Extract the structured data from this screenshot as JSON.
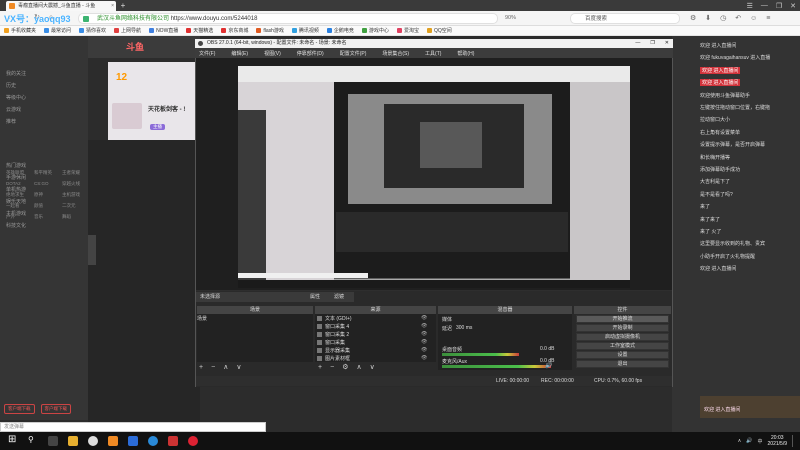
{
  "browser": {
    "tab_title": "毒瘤直播间大震撼_斗鱼直播 - 斗鱼",
    "tab_close": "×",
    "new_tab": "+",
    "window_controls": [
      "☰",
      "—",
      "❐",
      "✕"
    ],
    "nav": {
      "back": "‹",
      "forward": "›",
      "refresh": "↻",
      "home": "⌂"
    },
    "url_site": "武汉斗鱼网络科技有限公司",
    "url": "https://www.douyu.com/5244018",
    "zoom": "90%",
    "search_placeholder": "百度搜索",
    "bookmarks": [
      {
        "label": "手机收藏夹",
        "color": "#f0a020"
      },
      {
        "label": "最常访问",
        "color": "#3a8ee6"
      },
      {
        "label": "猜你喜欢",
        "color": "#3a8ee6"
      },
      {
        "label": "上网导航",
        "color": "#e04040"
      },
      {
        "label": "NOW直播",
        "color": "#4080e0"
      },
      {
        "label": "天猫精选",
        "color": "#e03030"
      },
      {
        "label": "京东商城",
        "color": "#e03030"
      },
      {
        "label": "flash游戏",
        "color": "#e05a20"
      },
      {
        "label": "腾讯视频",
        "color": "#30a0e0"
      },
      {
        "label": "企鹅电竞",
        "color": "#2a80e0"
      },
      {
        "label": "游戏中心",
        "color": "#40a040"
      },
      {
        "label": "爱淘宝",
        "color": "#e04060"
      },
      {
        "label": "QQ空间",
        "color": "#e0a020"
      }
    ]
  },
  "watermark": "VX号：yaoqq93",
  "douyu": {
    "logo": "斗鱼",
    "room_level": "12",
    "room_title": "天花板剑客 - !",
    "room_tag": "主播",
    "left_nav": {
      "items": [
        "我的关注",
        "历史",
        "等级中心",
        "云游戏",
        "推荐",
        "热门游戏",
        "手游休闲",
        "单机热游",
        "娱乐天地",
        "主机游戏",
        "科技文化"
      ],
      "grid": [
        "英雄联盟",
        "和平精英",
        "王者荣耀",
        "DOTA2",
        "CS:GO",
        "穿越火线",
        "绝地求生",
        "原神",
        "主机游戏",
        "一起看",
        "颜值",
        "二次元",
        "户外",
        "音乐",
        "舞蹈"
      ]
    },
    "nav_buttons": [
      "客户端下载",
      "客户端下载"
    ]
  },
  "obs": {
    "title": "OBS 27.0.1 (64-bit, windows) - 配置文件: 未命名 - 场景: 未命名",
    "window_controls": [
      "—",
      "❐",
      "✕"
    ],
    "menu": [
      "文件(F)",
      "编辑(E)",
      "视图(V)",
      "停靠部件(D)",
      "配置文件(P)",
      "场景集合(S)",
      "工具(T)",
      "帮助(H)"
    ],
    "tabs": {
      "scene_tab": "未选择源",
      "props": "属性",
      "filters": "滤镜"
    },
    "docks": {
      "scenes": "场景",
      "sources": "来源",
      "mixer": "混音器",
      "controls": "控件"
    },
    "scenes": [
      "场景"
    ],
    "sources": [
      "文本 (GDI+)",
      "窗口采集 4",
      "窗口采集 2",
      "窗口采集",
      "显示器采集",
      "图片素材框"
    ],
    "mixer": [
      {
        "label": "桌面音频",
        "value": "0.0 dB",
        "level": 0.62
      },
      {
        "label": "麦克风/Aux",
        "value": "0.0 dB",
        "level": 0.88
      }
    ],
    "mixer_labels": [
      "媒体",
      "延迟",
      "300 ms"
    ],
    "controls": [
      "开始推流",
      "开始录制",
      "启动虚拟摄像机",
      "工作室模式",
      "设置",
      "退出"
    ],
    "toolbar": [
      "+",
      "−",
      "∧",
      "∨"
    ],
    "status": {
      "live": "LIVE: 00:00:00",
      "rec": "REC: 00:00:00",
      "cpu": "CPU: 0.7%, 60.00 fps"
    }
  },
  "chat": {
    "lines": [
      "欢迎 进入直播间",
      "欢迎 fukuvagaihansuv 进入直播",
      "欢迎 进入直播间",
      "欢迎 进入直播间",
      "欢迎使用斗鱼弹幕助手",
      "左键按住拖动窗口位置，右键拖",
      "拉动窗口大小",
      "右上角有设置菜单",
      "设置提示弹幕，是否开启弹幕",
      "和长嗨开播等",
      "添加弹幕助手成功",
      "大吉利是下了",
      "是不是看了吗?",
      "来了",
      "来了来了",
      "来了 火了",
      "这里要显示收到的礼物、贵宾",
      "小助手开启了火礼物提醒",
      "欢迎 进入直播间"
    ],
    "highlight": "进入直播间",
    "banner": "欢迎 进入直播间"
  },
  "chat_input_placeholder": "发送弹幕",
  "taskbar": {
    "start": "⊞",
    "search": "⚲",
    "tray": [
      "∧",
      "🔊",
      "中"
    ],
    "time": "20:03",
    "date": "2021/5/9"
  }
}
